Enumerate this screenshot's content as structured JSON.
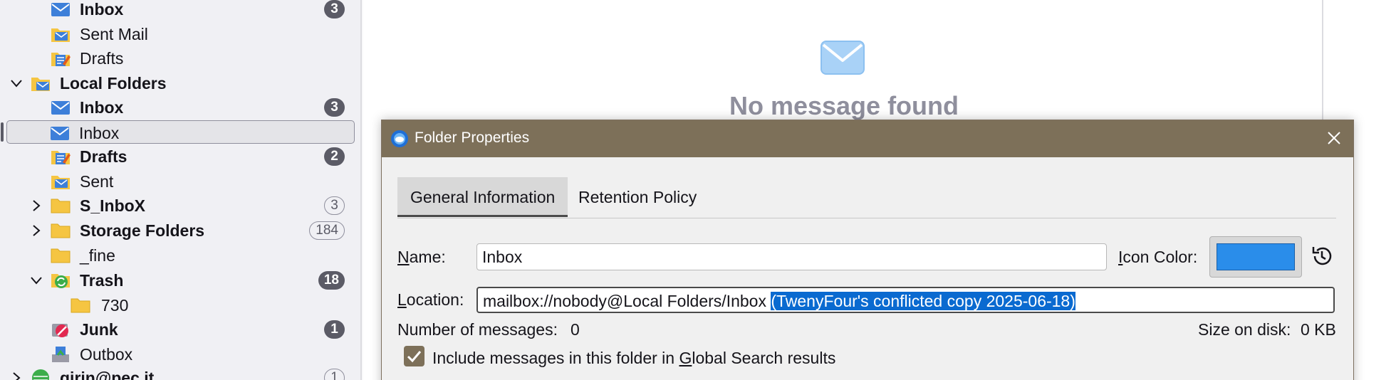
{
  "folders": [
    {
      "label": "Inbox",
      "bold": true,
      "badge": "3",
      "badge_style": "solid",
      "icon": "inbox-icon"
    },
    {
      "label": "Sent Mail",
      "bold": false,
      "icon": "sent-icon"
    },
    {
      "label": "Drafts",
      "bold": false,
      "icon": "drafts-icon"
    },
    {
      "label": "Local Folders",
      "bold": true,
      "icon": "local-folders-icon",
      "twisty": "chevron-down-icon"
    },
    {
      "label": "Inbox",
      "bold": true,
      "badge": "3",
      "badge_style": "solid",
      "icon": "inbox-icon"
    },
    {
      "label": "Inbox",
      "bold": false,
      "selected": true,
      "icon": "inbox-icon"
    },
    {
      "label": "Drafts",
      "bold": true,
      "badge": "2",
      "badge_style": "solid",
      "icon": "drafts-icon"
    },
    {
      "label": "Sent",
      "bold": false,
      "icon": "sent-icon"
    },
    {
      "label": "S_InboX",
      "bold": true,
      "badge": "3",
      "badge_style": "outline",
      "icon": "folder-icon",
      "twisty": "chevron-right-icon"
    },
    {
      "label": "Storage Folders",
      "bold": true,
      "badge": "184",
      "badge_style": "outline",
      "icon": "folder-icon",
      "twisty": "chevron-right-icon"
    },
    {
      "label": "_fine",
      "bold": false,
      "icon": "folder-icon"
    },
    {
      "label": "Trash",
      "bold": true,
      "badge": "18",
      "badge_style": "solid",
      "icon": "trash-icon",
      "twisty": "chevron-down-icon"
    },
    {
      "label": "730",
      "bold": false,
      "icon": "folder-icon"
    },
    {
      "label": "Junk",
      "bold": true,
      "badge": "1",
      "badge_style": "solid",
      "icon": "junk-icon"
    },
    {
      "label": "Outbox",
      "bold": false,
      "icon": "outbox-icon"
    },
    {
      "label": "girin@pec.it",
      "bold": true,
      "badge": "1",
      "badge_style": "outline",
      "icon": "account-icon",
      "twisty": "chevron-right-icon"
    }
  ],
  "message_pane": {
    "empty_text": "No message found"
  },
  "dialog": {
    "title": "Folder Properties",
    "tabs": [
      "General Information",
      "Retention Policy"
    ],
    "name_label_first": "N",
    "name_label_rest": "ame:",
    "name_value": "Inbox",
    "icon_color_label_first": "I",
    "icon_color_label_rest": "con Color:",
    "icon_color": "#2a8dea",
    "location_label_first": "L",
    "location_label_rest": "ocation:",
    "location_value": "mailbox://nobody@Local Folders/Inbox ",
    "location_selected": "(TwenyFour's conflicted copy 2025-06-18)",
    "num_messages_label": "Number of messages:",
    "num_messages_value": "0",
    "size_label": "Size on disk:",
    "size_value": "0 KB",
    "include_text_before": "Include messages in this folder in ",
    "include_text_underlined": "G",
    "include_text_after": "lobal Search results",
    "include_checked": true
  },
  "colors": {
    "titlebar": "#7d7059",
    "accent": "#2a8dea",
    "selection": "#0a6ad0"
  }
}
